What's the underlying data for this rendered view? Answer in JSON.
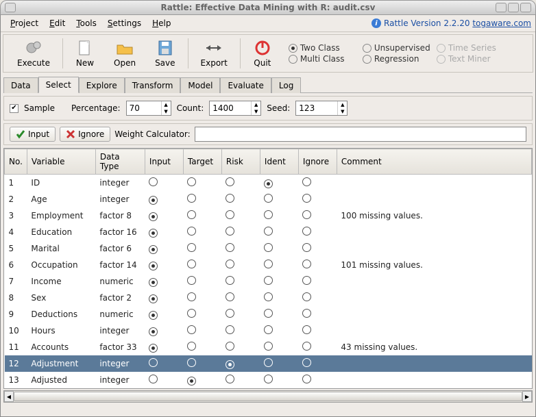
{
  "title": "Rattle: Effective Data Mining with R: audit.csv",
  "menus": [
    "Project",
    "Edit",
    "Tools",
    "Settings",
    "Help"
  ],
  "version_prefix": "Rattle Version 2.2.20 ",
  "version_link": "togaware.com",
  "toolbar": {
    "execute": "Execute",
    "new": "New",
    "open": "Open",
    "save": "Save",
    "export": "Export",
    "quit": "Quit"
  },
  "model_types": {
    "two_class": "Two Class",
    "unsupervised": "Unsupervised",
    "time_series": "Time Series",
    "multi_class": "Multi Class",
    "regression": "Regression",
    "text_miner": "Text Miner"
  },
  "tabs": [
    "Data",
    "Select",
    "Explore",
    "Transform",
    "Model",
    "Evaluate",
    "Log"
  ],
  "active_tab": "Select",
  "sample": {
    "label": "Sample",
    "pct_label": "Percentage:",
    "pct_value": "70",
    "count_label": "Count:",
    "count_value": "1400",
    "seed_label": "Seed:",
    "seed_value": "123"
  },
  "buttons": {
    "input": "Input",
    "ignore": "Ignore"
  },
  "weight_calc_label": "Weight Calculator:",
  "weight_calc_value": "",
  "columns": [
    "No.",
    "Variable",
    "Data Type",
    "Input",
    "Target",
    "Risk",
    "Ident",
    "Ignore",
    "Comment"
  ],
  "roles": [
    "input",
    "target",
    "risk",
    "ident",
    "ignore"
  ],
  "rows": [
    {
      "no": "1",
      "var": "ID",
      "type": "integer",
      "role": "ident",
      "comment": ""
    },
    {
      "no": "2",
      "var": "Age",
      "type": "integer",
      "role": "input",
      "comment": ""
    },
    {
      "no": "3",
      "var": "Employment",
      "type": "factor 8",
      "role": "input",
      "comment": "100 missing values."
    },
    {
      "no": "4",
      "var": "Education",
      "type": "factor 16",
      "role": "input",
      "comment": ""
    },
    {
      "no": "5",
      "var": "Marital",
      "type": "factor 6",
      "role": "input",
      "comment": ""
    },
    {
      "no": "6",
      "var": "Occupation",
      "type": "factor 14",
      "role": "input",
      "comment": "101 missing values."
    },
    {
      "no": "7",
      "var": "Income",
      "type": "numeric",
      "role": "input",
      "comment": ""
    },
    {
      "no": "8",
      "var": "Sex",
      "type": "factor 2",
      "role": "input",
      "comment": ""
    },
    {
      "no": "9",
      "var": "Deductions",
      "type": "numeric",
      "role": "input",
      "comment": ""
    },
    {
      "no": "10",
      "var": "Hours",
      "type": "integer",
      "role": "input",
      "comment": ""
    },
    {
      "no": "11",
      "var": "Accounts",
      "type": "factor 33",
      "role": "input",
      "comment": "43 missing values."
    },
    {
      "no": "12",
      "var": "Adjustment",
      "type": "integer",
      "role": "risk",
      "comment": "",
      "selected": true
    },
    {
      "no": "13",
      "var": "Adjusted",
      "type": "integer",
      "role": "target",
      "comment": ""
    }
  ]
}
